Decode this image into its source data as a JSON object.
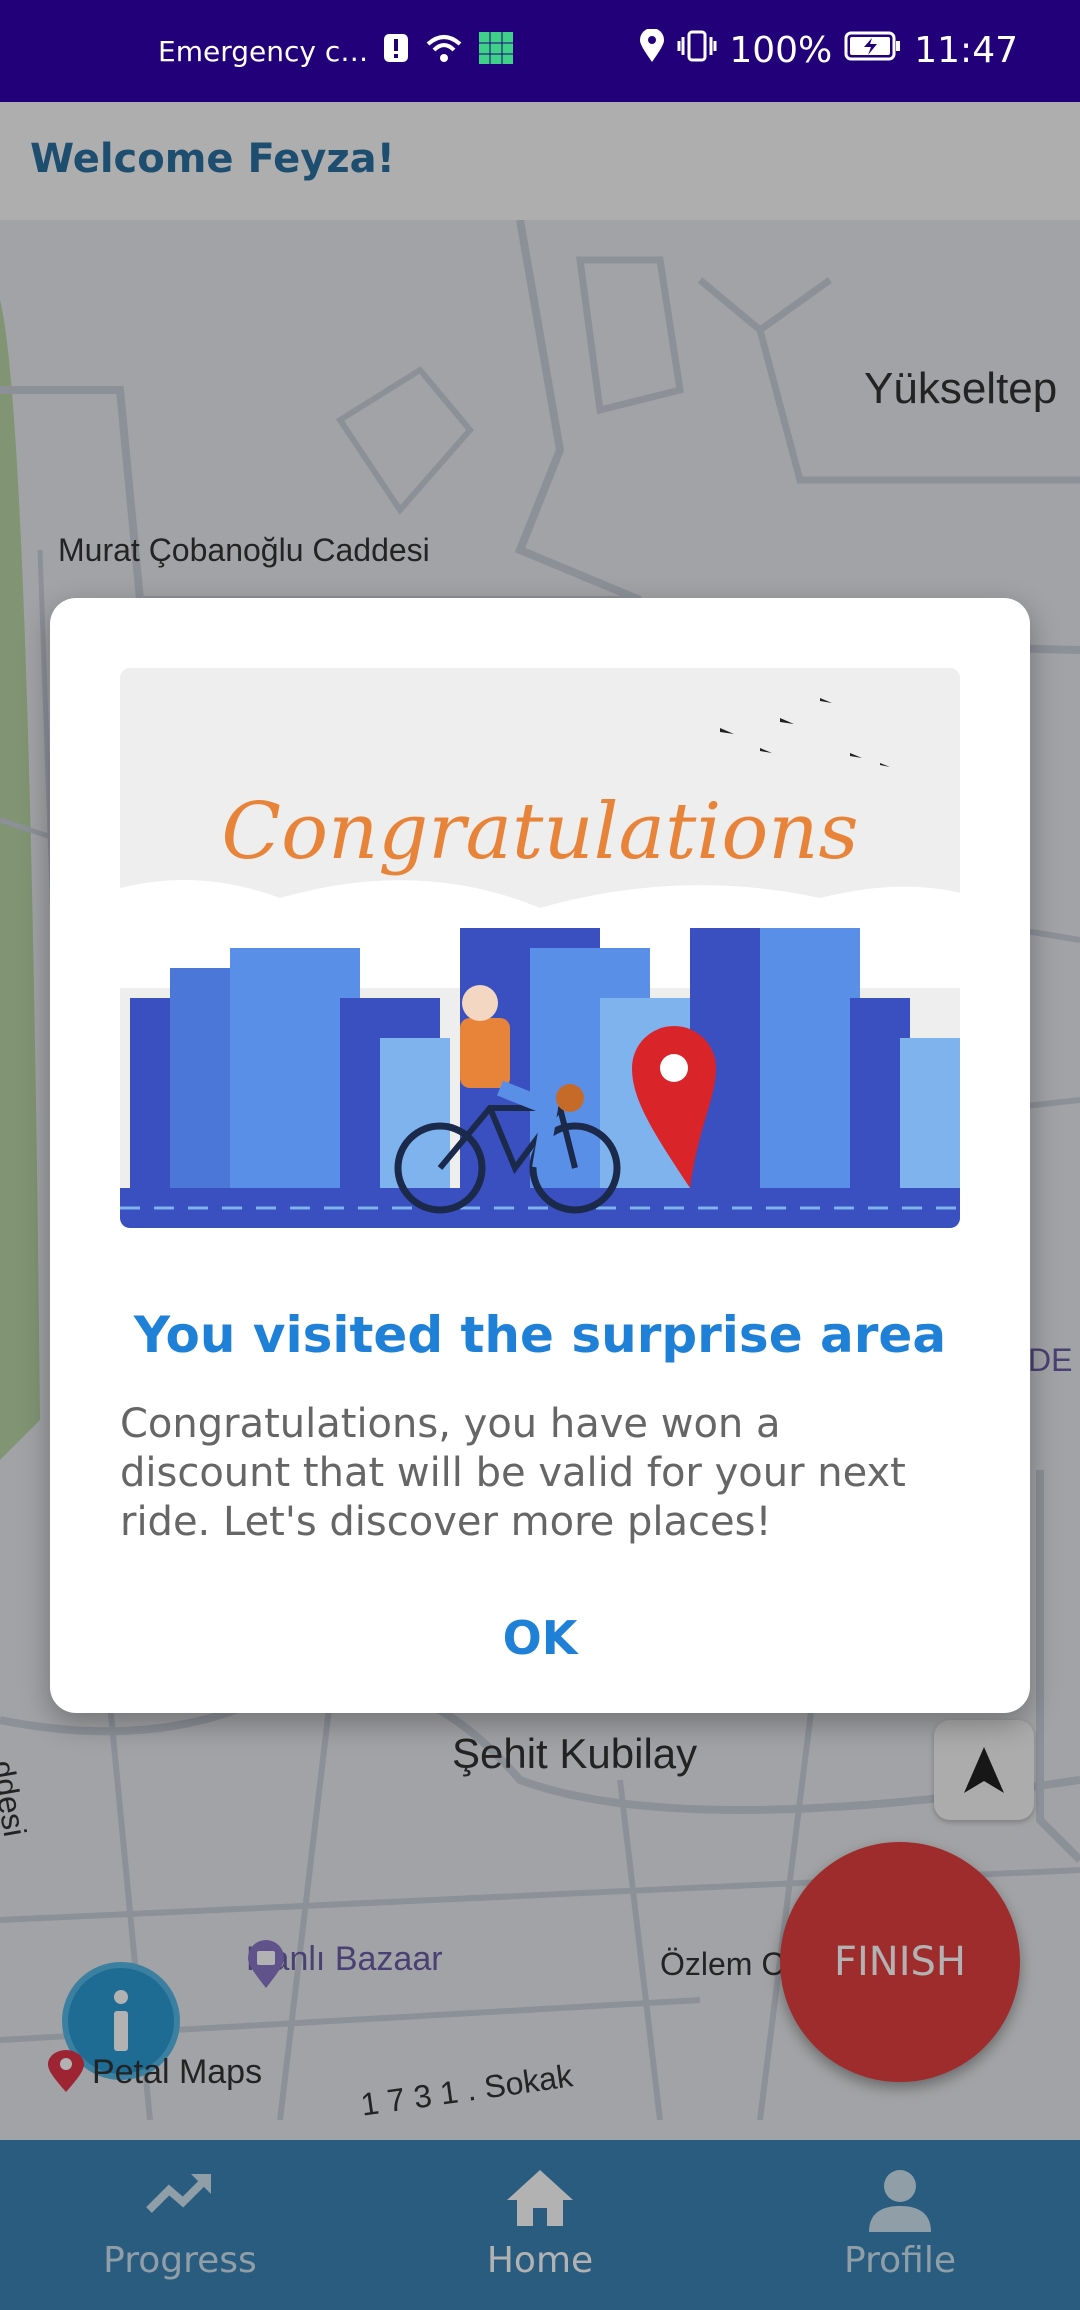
{
  "status_bar": {
    "carrier": "Emergency c…",
    "battery": "100%",
    "time": "11:47"
  },
  "header": {
    "title": "Welcome Feyza!"
  },
  "map": {
    "labels": {
      "street1": "Murat Çobanoğlu Caddesi",
      "district1": "Yükseltep",
      "district2": "Şehit Kubilay",
      "poi": "Hanlı Bazaar",
      "place": "Özlem C",
      "street2": "1 7 3 1 . Sokak",
      "street3": "ddesi",
      "edge": "DE"
    },
    "attribution": "Petal Maps"
  },
  "dialog": {
    "image_text": "Congratulations",
    "title": "You visited the surprise area",
    "message": "Congratulations, you have won a discount that will be valid for your next ride. Let's discover more places!",
    "ok_label": "OK"
  },
  "fab": {
    "finish_label": "FINISH"
  },
  "bottom_nav": {
    "items": [
      {
        "label": "Progress",
        "icon": "trending-up-icon"
      },
      {
        "label": "Home",
        "icon": "home-icon"
      },
      {
        "label": "Profile",
        "icon": "person-icon"
      }
    ],
    "active_index": 1
  },
  "colors": {
    "status_bar": "#22007a",
    "accent_blue": "#1f80d8",
    "nav_bar": "#3b84b6",
    "finish_red": "#e43f3f"
  }
}
